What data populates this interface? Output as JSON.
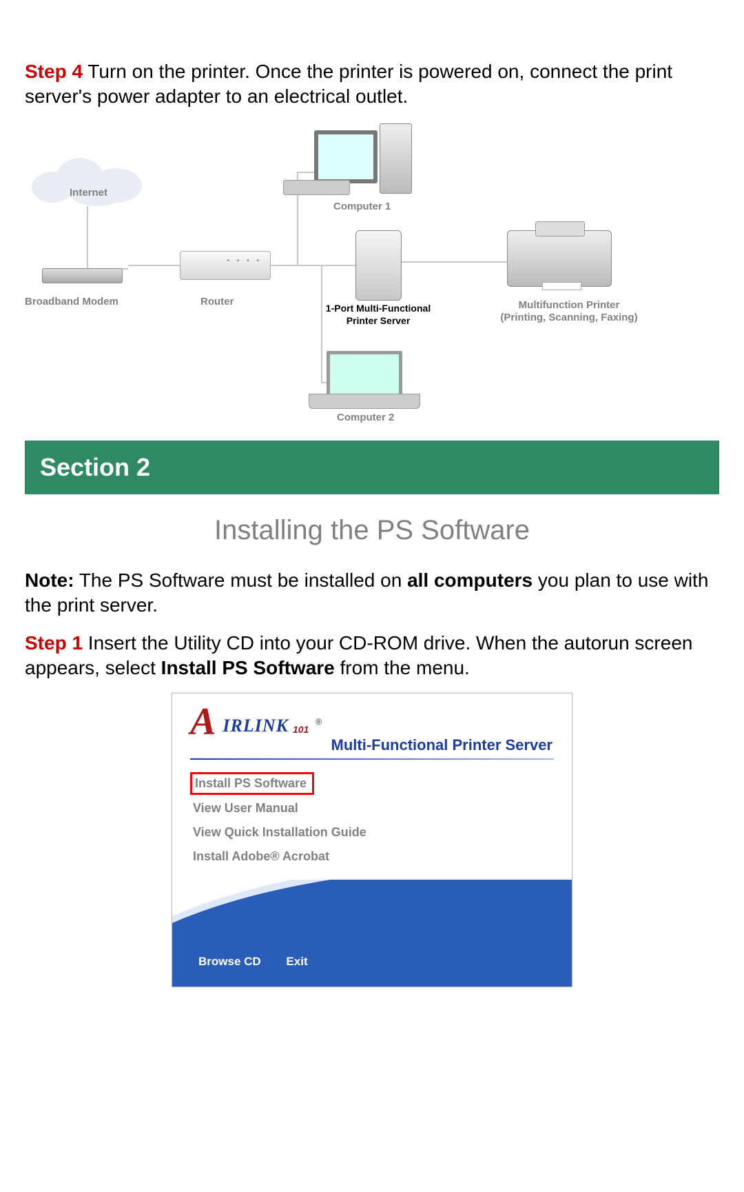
{
  "step4": {
    "label": "Step 4",
    "text": " Turn on the printer.  Once the printer is powered on, connect the print server's power adapter to an electrical outlet."
  },
  "diagram": {
    "internet": "Internet",
    "modem": "Broadband Modem",
    "router": "Router",
    "computer1": "Computer 1",
    "printserver_l1": "1-Port Multi-Functional",
    "printserver_l2": "Printer Server",
    "computer2": "Computer 2",
    "printer_l1": "Multifunction Printer",
    "printer_l2": "(Printing, Scanning, Faxing)"
  },
  "section": {
    "banner": "Section 2",
    "subtitle": "Installing the PS Software"
  },
  "note": {
    "label": "Note:",
    "t1": " The PS Software must be installed on ",
    "bold": "all computers",
    "t2": " you plan to use with the print server."
  },
  "step1": {
    "label": "Step 1",
    "t1": " Insert the Utility CD into your CD-ROM drive.  When the autorun screen appears, select ",
    "bold": "Install PS Software",
    "t2": " from the menu."
  },
  "autorun": {
    "logo_a": "A",
    "logo_text": "irLink",
    "logo_101": "101",
    "logo_reg": "®",
    "title": "Multi-Functional Printer Server",
    "menu": {
      "install_ps": "Install PS Software",
      "view_manual": "View User Manual",
      "view_qig": "View Quick Installation Guide",
      "install_acrobat": "Install Adobe® Acrobat"
    },
    "slashes": "//////",
    "browse_cd": "Browse CD",
    "exit": "Exit"
  }
}
